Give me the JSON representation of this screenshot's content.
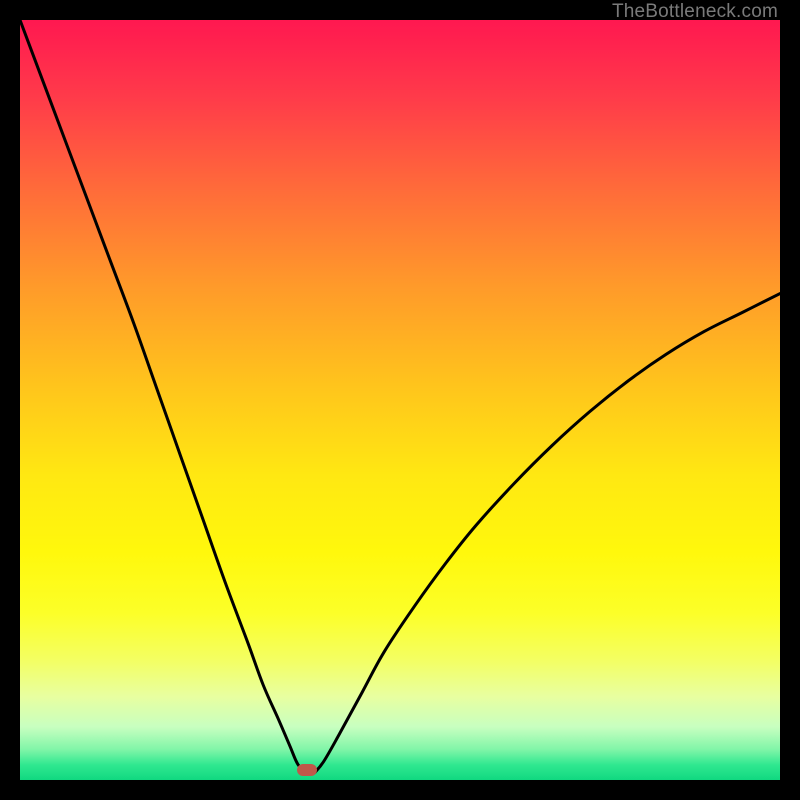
{
  "watermark": "TheBottleneck.com",
  "marker": {
    "x_pct": 37.8,
    "y_pct": 98.7,
    "color": "#c0584a"
  },
  "chart_data": {
    "type": "line",
    "title": "",
    "xlabel": "",
    "ylabel": "",
    "xlim": [
      0,
      100
    ],
    "ylim": [
      0,
      100
    ],
    "grid": false,
    "legend": false,
    "notes": "V-shaped bottleneck curve on a rainbow gradient. No axis ticks or numeric labels visible; x/y values are pixel-percent estimates from the plot.",
    "series": [
      {
        "name": "left-branch",
        "x": [
          0,
          3,
          6,
          9,
          12,
          15,
          18,
          21,
          24,
          27,
          30,
          32,
          34,
          35.5,
          36.6,
          37.8
        ],
        "y": [
          100,
          92,
          84,
          76,
          68,
          60,
          51.5,
          43,
          34.5,
          26,
          18,
          12.5,
          8,
          4.5,
          2,
          1
        ]
      },
      {
        "name": "right-branch",
        "x": [
          38.8,
          40,
          42,
          45,
          48,
          52,
          56,
          60,
          65,
          70,
          75,
          80,
          85,
          90,
          95,
          100
        ],
        "y": [
          1,
          2.5,
          6,
          11.5,
          17,
          23,
          28.5,
          33.5,
          39,
          44,
          48.5,
          52.5,
          56,
          59,
          61.5,
          64
        ]
      }
    ],
    "gradient_stops": [
      {
        "pct": 0,
        "color": "#ff1850"
      },
      {
        "pct": 10,
        "color": "#ff3a4a"
      },
      {
        "pct": 22,
        "color": "#ff6a3a"
      },
      {
        "pct": 35,
        "color": "#ff9a2a"
      },
      {
        "pct": 48,
        "color": "#ffc41c"
      },
      {
        "pct": 60,
        "color": "#ffe812"
      },
      {
        "pct": 70,
        "color": "#fff80c"
      },
      {
        "pct": 78,
        "color": "#fcff28"
      },
      {
        "pct": 84,
        "color": "#f4ff60"
      },
      {
        "pct": 89,
        "color": "#e8ffa0"
      },
      {
        "pct": 93,
        "color": "#c8ffc0"
      },
      {
        "pct": 96,
        "color": "#80f5a8"
      },
      {
        "pct": 98,
        "color": "#30e890"
      },
      {
        "pct": 100,
        "color": "#10d880"
      }
    ]
  }
}
